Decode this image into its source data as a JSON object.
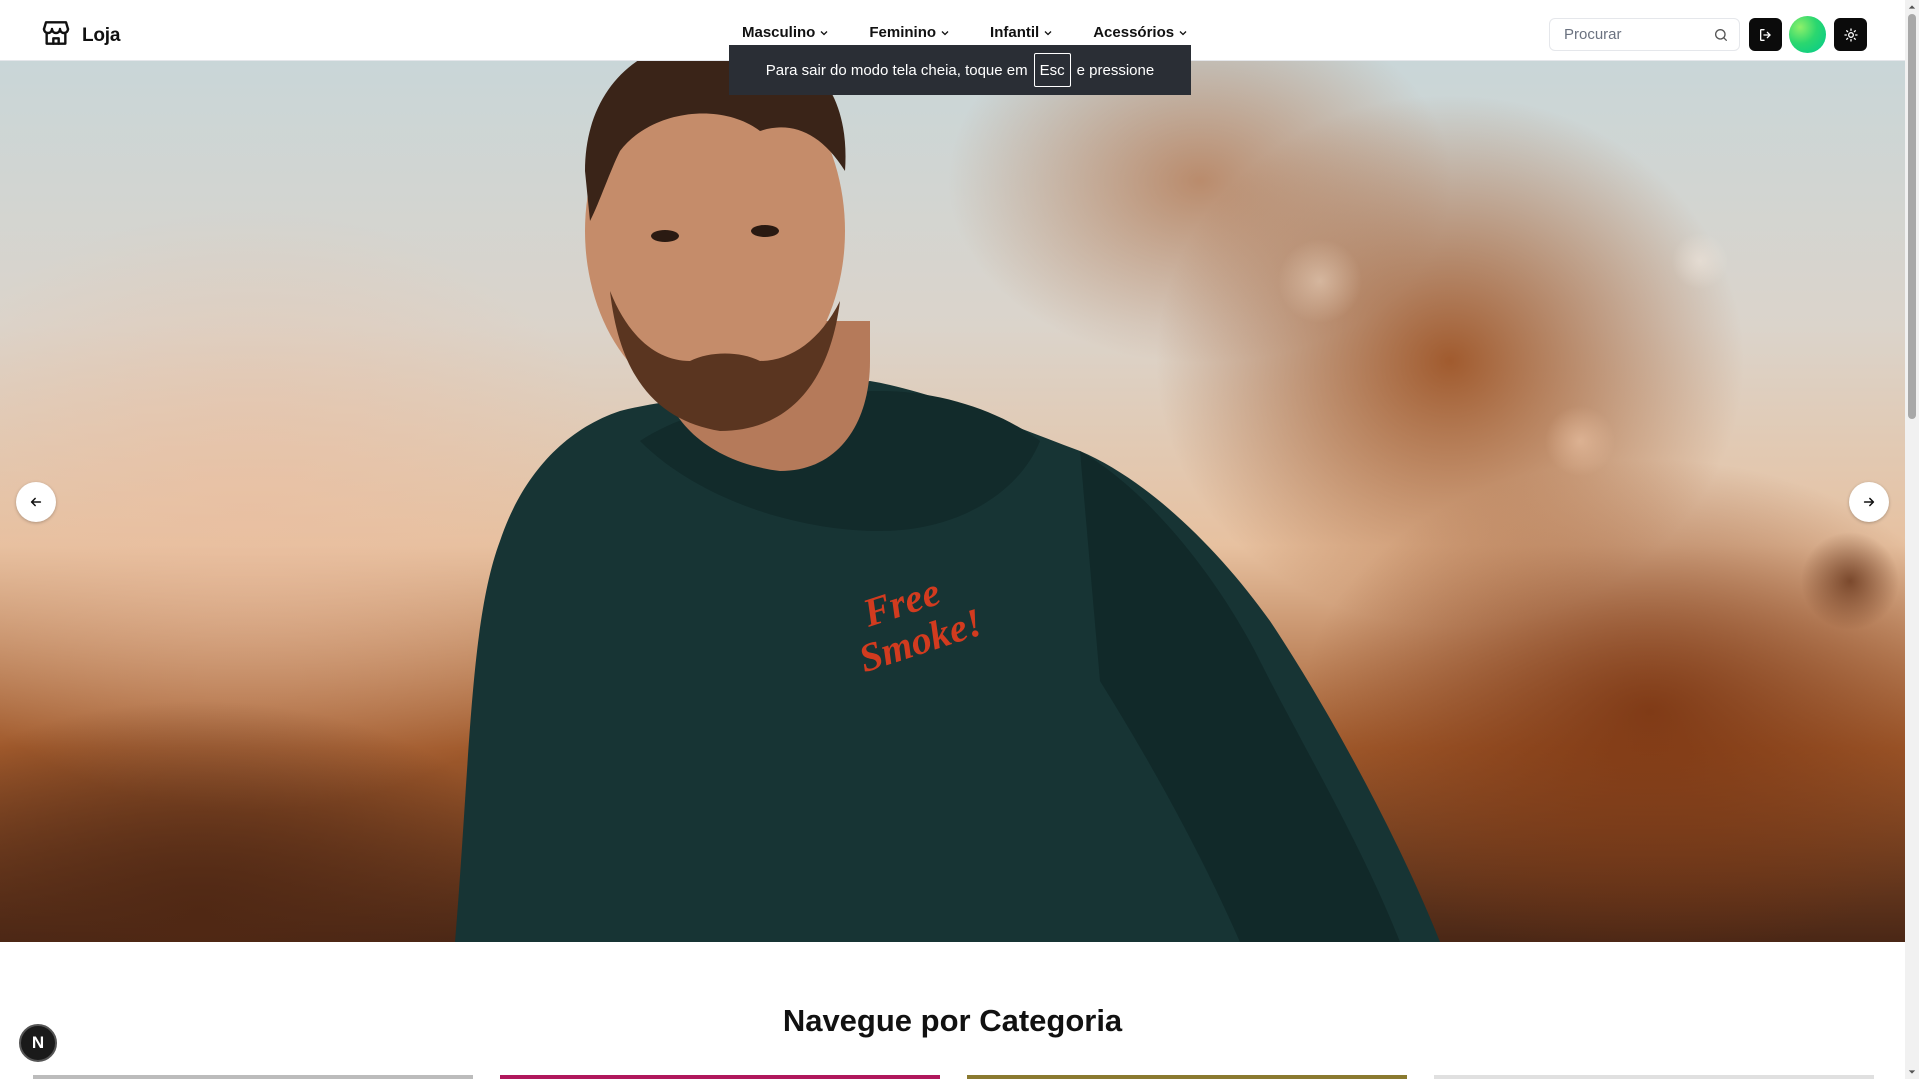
{
  "brand": {
    "name": "Loja",
    "icon": "store-icon"
  },
  "nav": [
    {
      "label": "Masculino"
    },
    {
      "label": "Feminino"
    },
    {
      "label": "Infantil"
    },
    {
      "label": "Acessórios"
    }
  ],
  "search": {
    "placeholder": "Procurar",
    "value": ""
  },
  "fullscreen_notice": {
    "prefix": "Para sair do modo tela cheia, toque em",
    "key": "Esc",
    "suffix": "e pressione"
  },
  "hero": {
    "shirt_text_line1": "Free",
    "shirt_text_line2": "Smoke!"
  },
  "category": {
    "title": "Navegue por Categoria"
  },
  "next_badge": {
    "label": "N"
  },
  "colors": {
    "accent_dark": "#0b0b0b",
    "toast_bg": "#2a2e35",
    "avatar_gradient": [
      "#8ef06a",
      "#00c98d"
    ],
    "shirt_text": "#d23b1f",
    "sweatshirt": "#143232"
  }
}
